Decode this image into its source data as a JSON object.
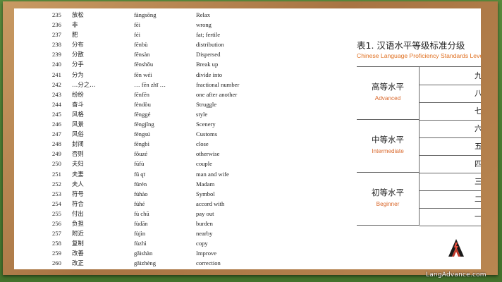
{
  "vocab": [
    {
      "num": "235",
      "hanzi": "放松",
      "pinyin": "fàngsōng",
      "english": "Relax"
    },
    {
      "num": "236",
      "hanzi": "非",
      "pinyin": "fēi",
      "english": "wrong"
    },
    {
      "num": "237",
      "hanzi": "肥",
      "pinyin": "féi",
      "english": "fat; fertile"
    },
    {
      "num": "238",
      "hanzi": "分布",
      "pinyin": "fēnbù",
      "english": "distribution"
    },
    {
      "num": "239",
      "hanzi": "分散",
      "pinyin": "fēnsàn",
      "english": "Dispersed"
    },
    {
      "num": "240",
      "hanzi": "分手",
      "pinyin": "fēnshǒu",
      "english": "Break up"
    },
    {
      "num": "241",
      "hanzi": "分为",
      "pinyin": "fēn wéi",
      "english": "divide into"
    },
    {
      "num": "242",
      "hanzi": "…分之…",
      "pinyin": "… fēn zhī …",
      "english": "fractional number"
    },
    {
      "num": "243",
      "hanzi": "纷纷",
      "pinyin": "fēnfēn",
      "english": "one after another"
    },
    {
      "num": "244",
      "hanzi": "奋斗",
      "pinyin": "fèndòu",
      "english": "Struggle"
    },
    {
      "num": "245",
      "hanzi": "风格",
      "pinyin": "fēnggé",
      "english": "style"
    },
    {
      "num": "246",
      "hanzi": "风景",
      "pinyin": "fēngjǐng",
      "english": "Scenery"
    },
    {
      "num": "247",
      "hanzi": "风俗",
      "pinyin": "fēngsú",
      "english": "Customs"
    },
    {
      "num": "248",
      "hanzi": "封闭",
      "pinyin": "fēngbì",
      "english": "close"
    },
    {
      "num": "249",
      "hanzi": "否则",
      "pinyin": "fǒuzé",
      "english": "otherwise"
    },
    {
      "num": "250",
      "hanzi": "夫妇",
      "pinyin": "fūfù",
      "english": "couple"
    },
    {
      "num": "251",
      "hanzi": "夫妻",
      "pinyin": "fū qī",
      "english": "man and wife"
    },
    {
      "num": "252",
      "hanzi": "夫人",
      "pinyin": "fūrén",
      "english": "Madam"
    },
    {
      "num": "253",
      "hanzi": "符号",
      "pinyin": "fúhào",
      "english": "Symbol"
    },
    {
      "num": "254",
      "hanzi": "符合",
      "pinyin": "fúhé",
      "english": "accord with"
    },
    {
      "num": "255",
      "hanzi": "付出",
      "pinyin": "fù chū",
      "english": "pay out"
    },
    {
      "num": "256",
      "hanzi": "负担",
      "pinyin": "fùdān",
      "english": "burden"
    },
    {
      "num": "257",
      "hanzi": "附近",
      "pinyin": "fùjìn",
      "english": "nearby"
    },
    {
      "num": "258",
      "hanzi": "复制",
      "pinyin": "fùzhì",
      "english": "copy"
    },
    {
      "num": "259",
      "hanzi": "改善",
      "pinyin": "gǎishàn",
      "english": "Improve"
    },
    {
      "num": "260",
      "hanzi": "改正",
      "pinyin": "gǎizhèng",
      "english": "correction"
    }
  ],
  "standards_table": {
    "title": "表1. 汉语水平等级标准分级",
    "subtitle": "Chinese Language Proficiency Standards Leve",
    "groups": [
      {
        "cn": "高等水平",
        "en": "Advanced",
        "levels": [
          "九级",
          "八级",
          "七级"
        ]
      },
      {
        "cn": "中等水平",
        "en": "Intermediate",
        "levels": [
          "六级",
          "五级",
          "四级"
        ]
      },
      {
        "cn": "初等水平",
        "en": "Beginner",
        "levels": [
          "三级",
          "二级",
          "一级"
        ]
      }
    ]
  },
  "footer": {
    "site": "LangAdvance.com",
    "logo_icon": "langadvance-logo-icon"
  },
  "colors": {
    "board_green": "#4d7d33",
    "frame_wood": "#a87443",
    "accent_orange": "#e06f1f"
  }
}
